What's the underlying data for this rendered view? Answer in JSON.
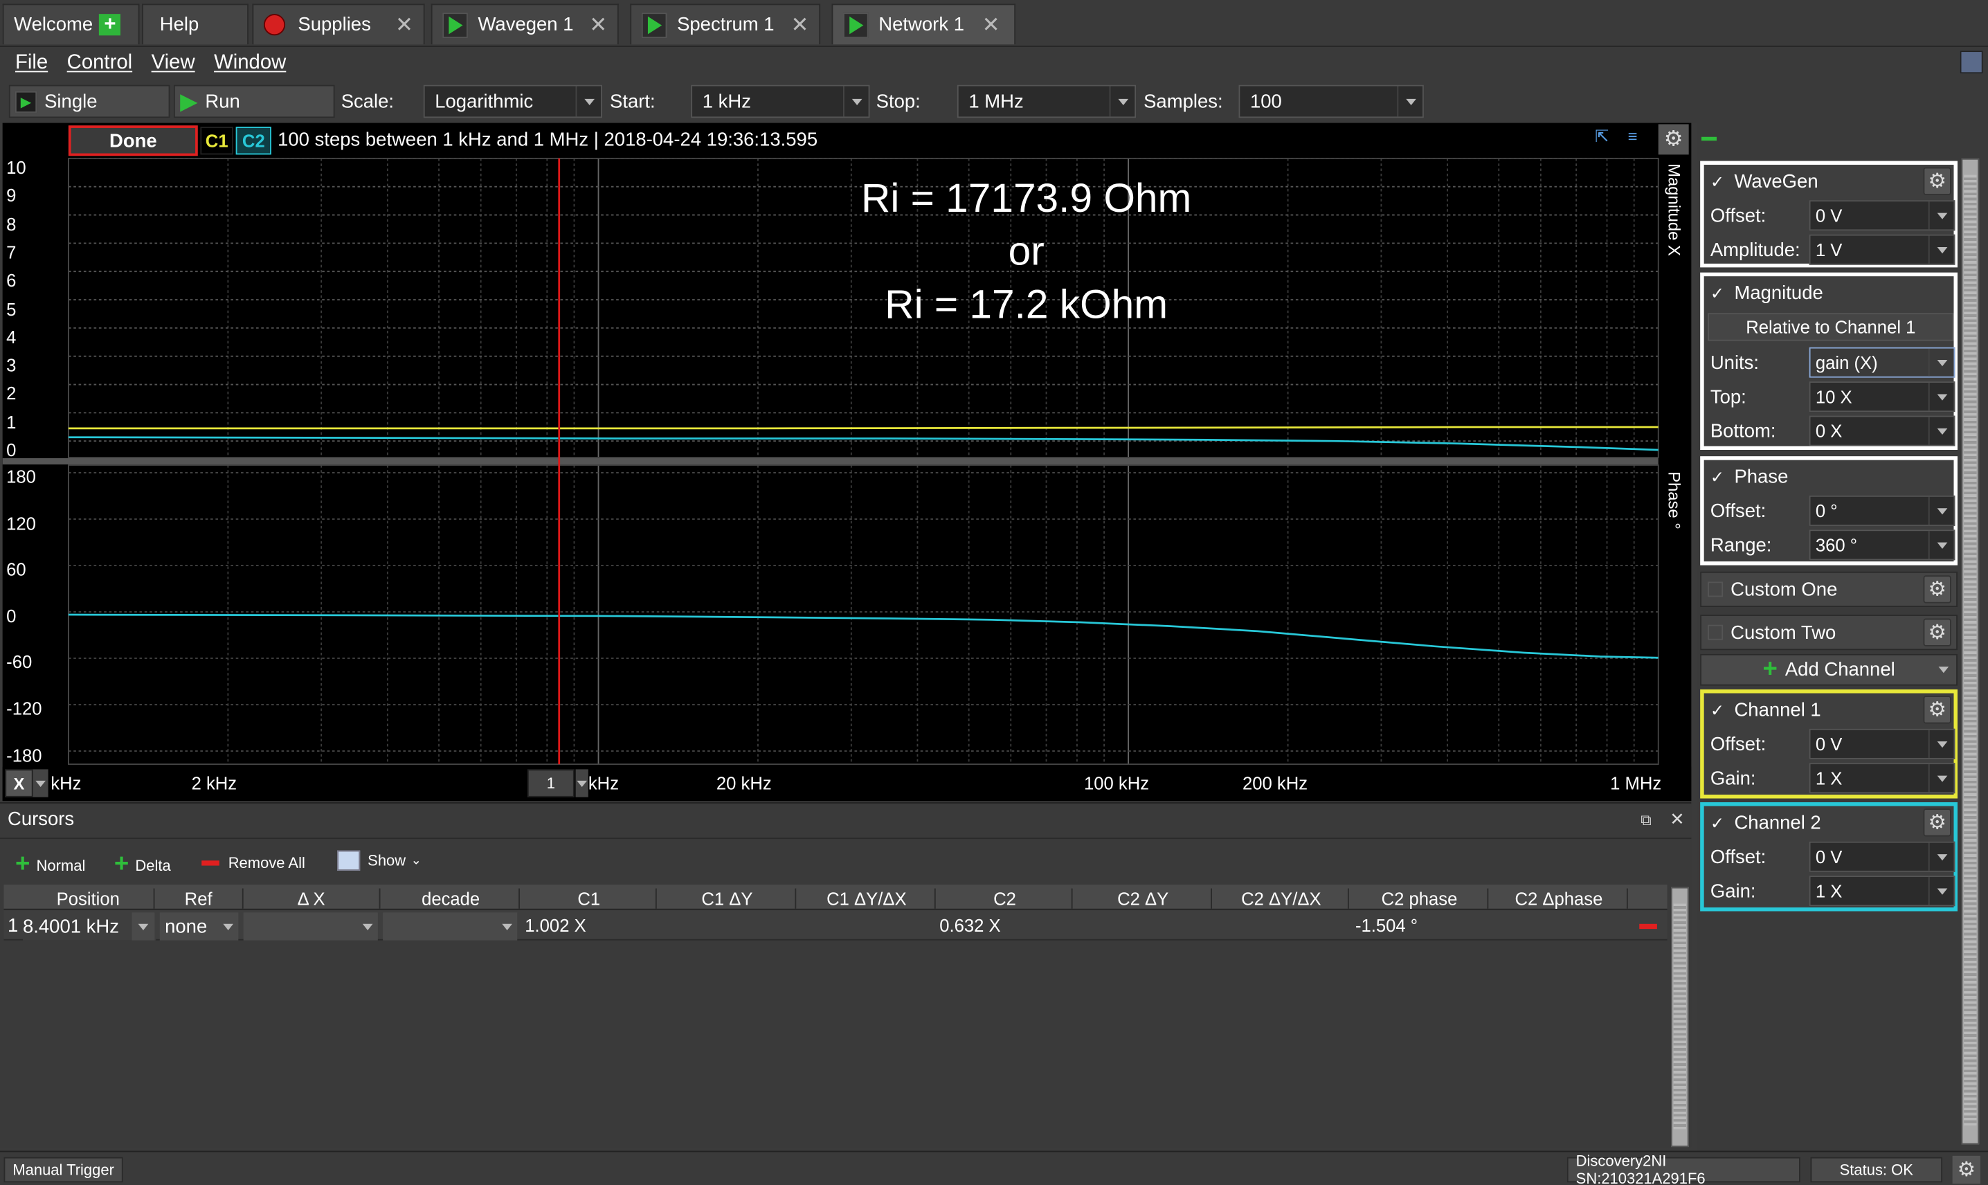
{
  "tabs": [
    {
      "label": "Welcome"
    },
    {
      "label": "Help"
    },
    {
      "label": "Supplies"
    },
    {
      "label": "Wavegen 1"
    },
    {
      "label": "Spectrum 1"
    },
    {
      "label": "Network 1"
    }
  ],
  "menu": {
    "file": "File",
    "control": "Control",
    "view": "View",
    "window": "Window"
  },
  "toolbar": {
    "single": "Single",
    "run": "Run",
    "scale_label": "Scale:",
    "scale_value": "Logarithmic",
    "start_label": "Start:",
    "start_value": "1 kHz",
    "stop_label": "Stop:",
    "stop_value": "1 MHz",
    "samples_label": "Samples:",
    "samples_value": "100"
  },
  "plot": {
    "status": "Done",
    "c1": "C1",
    "c2": "C2",
    "info": "100 steps  between 1 kHz and 1 MHz | 2018-04-24 19:36:13.595",
    "annotation": [
      "Ri = 17173.9 Ohm",
      "or",
      "Ri = 17.2 kOhm"
    ],
    "magnitude_axis_title": "Magnitude X",
    "phase_axis_title": "Phase °",
    "magnitude_ticks": [
      "10",
      "9",
      "8",
      "7",
      "6",
      "5",
      "4",
      "3",
      "2",
      "1",
      "0"
    ],
    "phase_ticks": [
      "180",
      "120",
      "60",
      "0",
      "-60",
      "-120",
      "-180"
    ],
    "x_ticks": [
      "kHz",
      "2 kHz",
      "kHz",
      "20 kHz",
      "100 kHz",
      "200 kHz",
      "1 MHz"
    ],
    "x_button": "X",
    "cursor_box": "1"
  },
  "cursors": {
    "title": "Cursors",
    "normal": "Normal",
    "delta": "Delta",
    "remove_all": "Remove All",
    "show": "Show",
    "headers": [
      "Position",
      "Ref",
      "Δ X",
      "decade",
      "C1",
      "C1 ΔY",
      "C1 ΔY/ΔX",
      "C2",
      "C2 ΔY",
      "C2 ΔY/ΔX",
      "C2 phase",
      "C2 Δphase"
    ],
    "row": {
      "index": "1",
      "position": "8.4001 kHz",
      "ref": "none",
      "c1": "1.002 X",
      "c2": "0.632 X",
      "c2_phase": "-1.504 °"
    }
  },
  "side": {
    "wavegen": {
      "title": "WaveGen",
      "offset_label": "Offset:",
      "offset": "0 V",
      "amplitude_label": "Amplitude:",
      "amplitude": "1 V"
    },
    "magnitude": {
      "title": "Magnitude",
      "relative": "Relative to Channel 1",
      "units_label": "Units:",
      "units": "gain (X)",
      "top_label": "Top:",
      "top": "10 X",
      "bottom_label": "Bottom:",
      "bottom": "0 X"
    },
    "phase": {
      "title": "Phase",
      "offset_label": "Offset:",
      "offset": "0 °",
      "range_label": "Range:",
      "range": "360 °"
    },
    "custom_one": "Custom One",
    "custom_two": "Custom Two",
    "add_channel": "Add Channel",
    "channel1": {
      "title": "Channel 1",
      "offset_label": "Offset:",
      "offset": "0 V",
      "gain_label": "Gain:",
      "gain": "1 X"
    },
    "channel2": {
      "title": "Channel 2",
      "offset_label": "Offset:",
      "offset": "0 V",
      "gain_label": "Gain:",
      "gain": "1 X"
    }
  },
  "status": {
    "manual_trigger": "Manual Trigger",
    "device": "Discovery2NI SN:210321A291F6",
    "status": "Status: OK"
  },
  "colors": {
    "c1": "#e8e83a",
    "c2": "#28c8d8",
    "cursor": "#e01818",
    "done_border": "#e02020"
  }
}
